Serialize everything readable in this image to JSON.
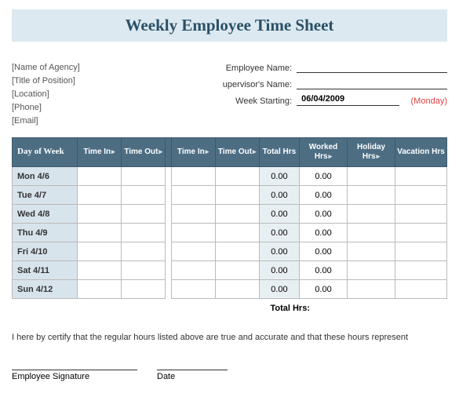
{
  "title": "Weekly Employee Time Sheet",
  "agency": {
    "name": "[Name of Agency]",
    "position": "[Title of Position]",
    "location": "[Location]",
    "phone": "[Phone]",
    "email": "[Email]"
  },
  "fields": {
    "employee_label": "Employee Name:",
    "employee_value": "",
    "supervisor_label": "upervisor's Name:",
    "supervisor_value": "",
    "week_label": "Week Starting:",
    "week_value": "06/04/2009",
    "week_day": "(Monday)"
  },
  "headers": {
    "day": "Day of Week",
    "time_in": "Time In",
    "time_out": "Time Out",
    "total_hrs": "Total Hrs",
    "worked_hrs": "Worked Hrs",
    "holiday_hrs": "Holiday Hrs",
    "vacation_hrs": "Vacation Hrs"
  },
  "rows": [
    {
      "day": "Mon 4/6",
      "total": "0.00",
      "worked": "0.00"
    },
    {
      "day": "Tue 4/7",
      "total": "0.00",
      "worked": "0.00"
    },
    {
      "day": "Wed 4/8",
      "total": "0.00",
      "worked": "0.00"
    },
    {
      "day": "Thu 4/9",
      "total": "0.00",
      "worked": "0.00"
    },
    {
      "day": "Fri 4/10",
      "total": "0.00",
      "worked": "0.00"
    },
    {
      "day": "Sat 4/11",
      "total": "0.00",
      "worked": "0.00"
    },
    {
      "day": "Sun 4/12",
      "total": "0.00",
      "worked": "0.00"
    }
  ],
  "total_label": "Total Hrs:",
  "certify": "I here by certify that the regular hours listed above are true and accurate and that these hours represent",
  "sig_employee": "Employee Signature",
  "sig_date": "Date"
}
